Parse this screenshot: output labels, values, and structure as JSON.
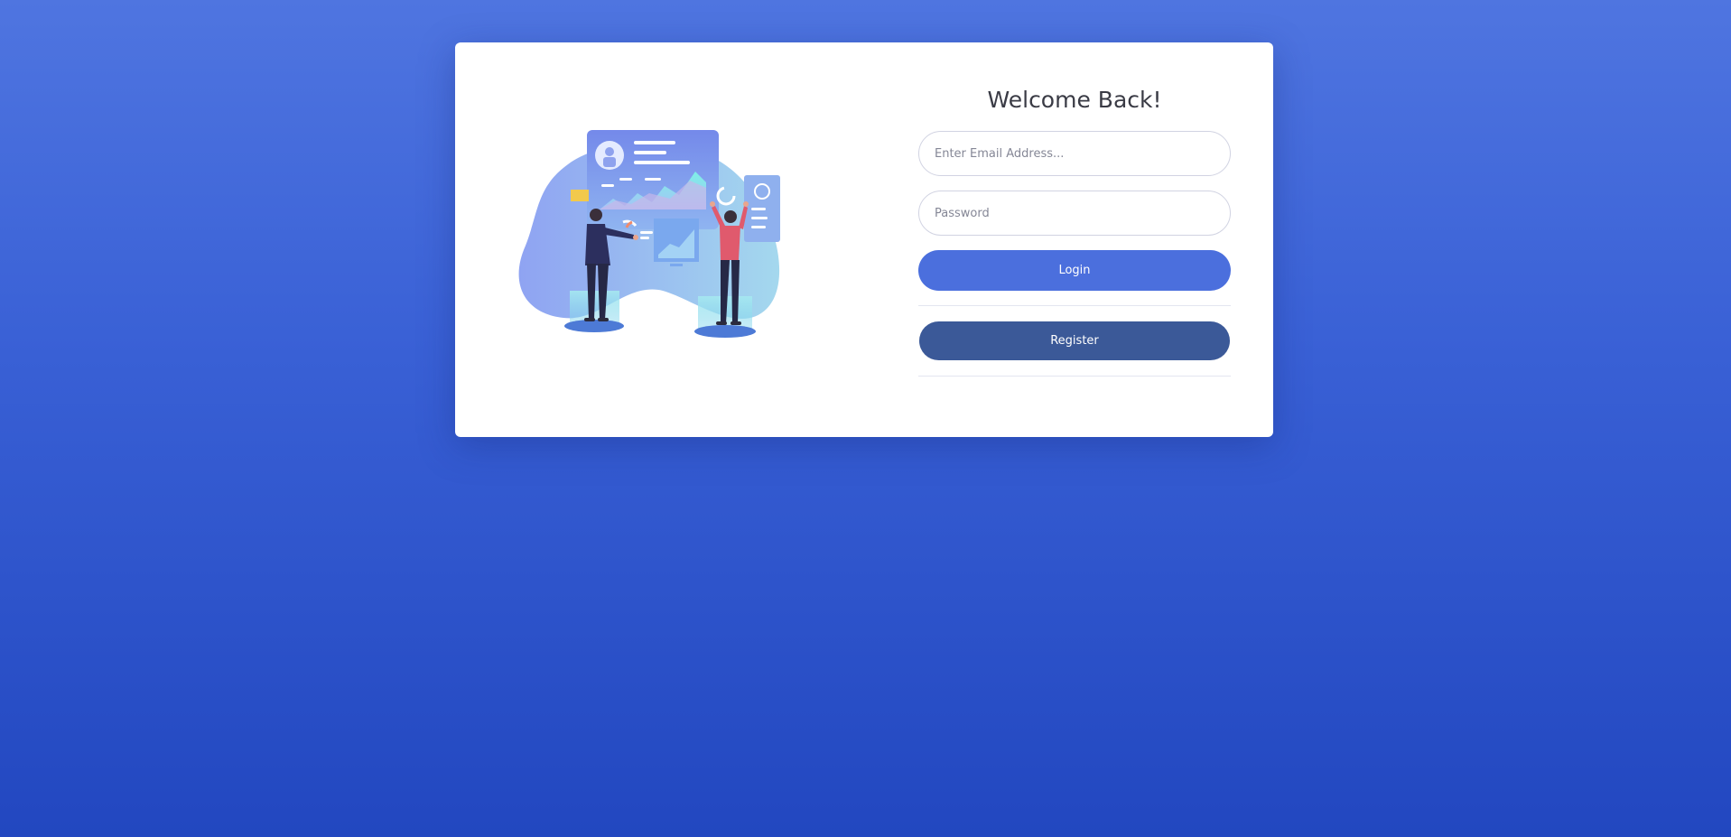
{
  "login": {
    "title": "Welcome Back!",
    "email_placeholder": "Enter Email Address...",
    "password_placeholder": "Password",
    "login_label": "Login",
    "register_label": "Register"
  },
  "colors": {
    "background_top": "#4f75e0",
    "background_bottom": "#2247c0",
    "login_button": "#4b6fdd",
    "register_button": "#3b5998",
    "title_text": "#3a3b45"
  },
  "illustration": {
    "icon": "analytics-dashboard-illustration"
  }
}
